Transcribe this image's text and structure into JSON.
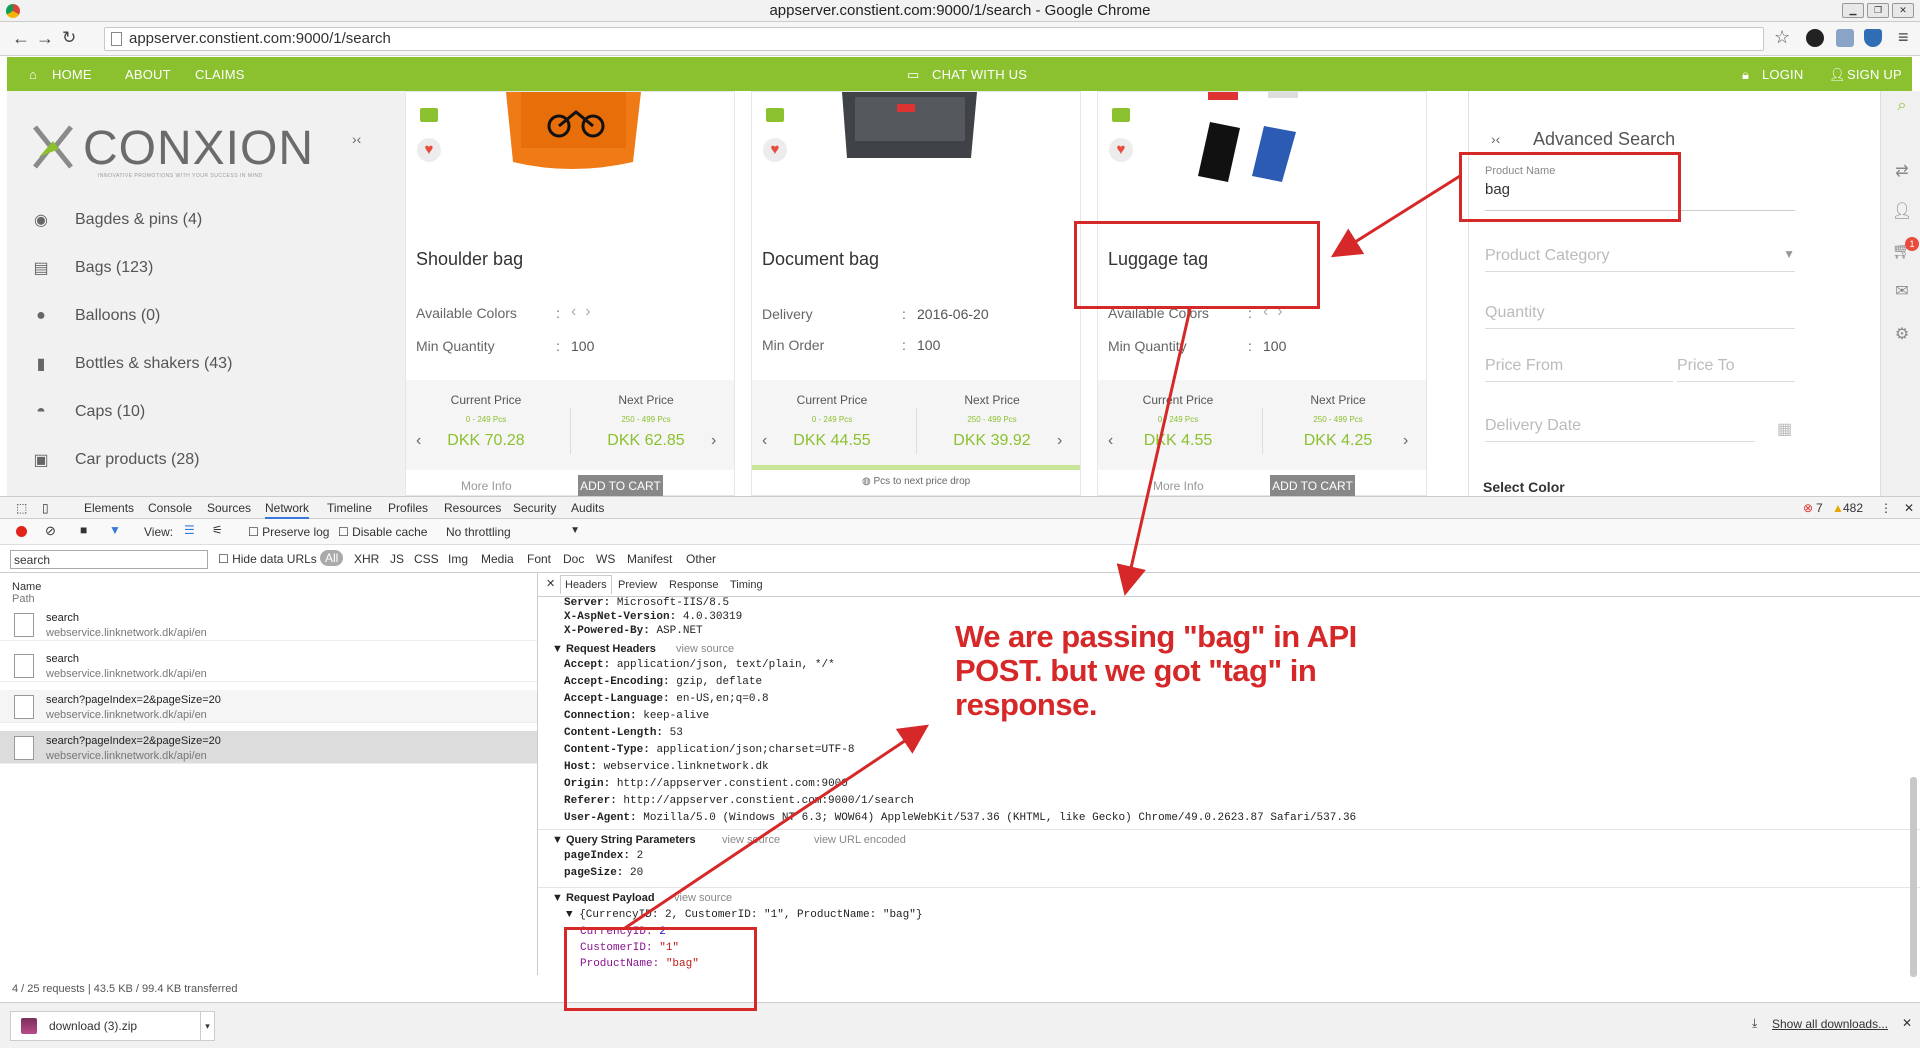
{
  "window": {
    "title": "appserver.constient.com:9000/1/search - Google Chrome"
  },
  "browser": {
    "url": "appserver.constient.com:9000/1/search"
  },
  "sitenav": {
    "home": "HOME",
    "about": "ABOUT",
    "claims": "CLAIMS",
    "chat": "CHAT WITH US",
    "login": "LOGIN",
    "signup": "SIGN UP"
  },
  "brand": {
    "name": "CONXION",
    "tagline": "INNOVATIVE PROMOTIONS WITH YOUR SUCCESS IN MIND"
  },
  "categories": [
    {
      "label": "Bagdes & pins (4)",
      "icon": "badge-icon"
    },
    {
      "label": "Bags (123)",
      "icon": "bag-icon"
    },
    {
      "label": "Balloons (0)",
      "icon": "balloon-icon"
    },
    {
      "label": "Bottles & shakers (43)",
      "icon": "bottle-icon"
    },
    {
      "label": "Caps (10)",
      "icon": "cap-icon"
    },
    {
      "label": "Car products (28)",
      "icon": "car-icon"
    }
  ],
  "products": [
    {
      "title": "Shoulder bag",
      "l1": "Available Colors",
      "v1": "",
      "l2": "Min Quantity",
      "v2": "100",
      "current": "Current Price",
      "next": "Next Price",
      "r1": "0 - 249 Pcs",
      "r2": "250 - 499 Pcs",
      "p1": "DKK 70.28",
      "p2": "DKK 62.85",
      "more": "More Info",
      "cart": "ADD TO CART",
      "note": ""
    },
    {
      "title": "Document bag",
      "l1": "Delivery",
      "v1": "2016-06-20",
      "l2": "Min Order",
      "v2": "100",
      "current": "Current Price",
      "next": "Next Price",
      "r1": "0 - 249 Pcs",
      "r2": "250 - 499 Pcs",
      "p1": "DKK 44.55",
      "p2": "DKK 39.92",
      "more": "",
      "cart": "",
      "note": "Pcs to next price drop"
    },
    {
      "title": "Luggage tag",
      "l1": "Available Colors",
      "v1": "",
      "l2": "Min Quantity",
      "v2": "100",
      "current": "Current Price",
      "next": "Next Price",
      "r1": "0 - 249 Pcs",
      "r2": "250 - 499 Pcs",
      "p1": "DKK 4.55",
      "p2": "DKK 4.25",
      "more": "More Info",
      "cart": "ADD TO CART",
      "note": ""
    }
  ],
  "advanced": {
    "title": "Advanced Search",
    "product_name_label": "Product Name",
    "product_name_value": "bag",
    "category": "Product Category",
    "quantity": "Quantity",
    "price_from": "Price From",
    "price_to": "Price To",
    "delivery": "Delivery Date",
    "select_color": "Select Color",
    "cart_count": "1"
  },
  "devtools": {
    "tabs": [
      "Elements",
      "Console",
      "Sources",
      "Network",
      "Timeline",
      "Profiles",
      "Resources",
      "Security",
      "Audits"
    ],
    "errors": "7",
    "warnings": "482",
    "view_label": "View:",
    "preserve_log": "Preserve log",
    "disable_cache": "Disable cache",
    "throttle": "No throttling",
    "filter_value": "search",
    "hide_data_urls": "Hide data URLs",
    "filters": [
      "All",
      "XHR",
      "JS",
      "CSS",
      "Img",
      "Media",
      "Font",
      "Doc",
      "WS",
      "Manifest",
      "Other"
    ],
    "col_name": "Name",
    "col_path": "Path",
    "requests": [
      {
        "name": "search",
        "path": "webservice.linknetwork.dk/api/en"
      },
      {
        "name": "search",
        "path": "webservice.linknetwork.dk/api/en"
      },
      {
        "name": "search?pageIndex=2&pageSize=20",
        "path": "webservice.linknetwork.dk/api/en"
      },
      {
        "name": "search?pageIndex=2&pageSize=20",
        "path": "webservice.linknetwork.dk/api/en"
      }
    ],
    "detail_tabs": [
      "Headers",
      "Preview",
      "Response",
      "Timing"
    ],
    "response_headers": [
      {
        "k": "Server:",
        "v": "Microsoft-IIS/8.5"
      },
      {
        "k": "X-AspNet-Version:",
        "v": "4.0.30319"
      },
      {
        "k": "X-Powered-By:",
        "v": "ASP.NET"
      }
    ],
    "request_headers_title": "Request Headers",
    "view_source": "view source",
    "view_url_encoded": "view URL encoded",
    "request_headers": [
      {
        "k": "Accept:",
        "v": "application/json, text/plain, */*"
      },
      {
        "k": "Accept-Encoding:",
        "v": "gzip, deflate"
      },
      {
        "k": "Accept-Language:",
        "v": "en-US,en;q=0.8"
      },
      {
        "k": "Connection:",
        "v": "keep-alive"
      },
      {
        "k": "Content-Length:",
        "v": "53"
      },
      {
        "k": "Content-Type:",
        "v": "application/json;charset=UTF-8"
      },
      {
        "k": "Host:",
        "v": "webservice.linknetwork.dk"
      },
      {
        "k": "Origin:",
        "v": "http://appserver.constient.com:9000"
      },
      {
        "k": "Referer:",
        "v": "http://appserver.constient.com:9000/1/search"
      },
      {
        "k": "User-Agent:",
        "v": "Mozilla/5.0 (Windows NT 6.3; WOW64) AppleWebKit/537.36 (KHTML, like Gecko) Chrome/49.0.2623.87 Safari/537.36"
      }
    ],
    "query_title": "Query String Parameters",
    "query": [
      {
        "k": "pageIndex:",
        "v": "2"
      },
      {
        "k": "pageSize:",
        "v": "20"
      }
    ],
    "payload_title": "Request Payload",
    "payload_summary": "{CurrencyID: 2, CustomerID: \"1\", ProductName: \"bag\"}",
    "payload": [
      {
        "k": "CurrencyID:",
        "v": "2"
      },
      {
        "k": "CustomerID:",
        "v": "\"1\""
      },
      {
        "k": "ProductName:",
        "v": "\"bag\""
      }
    ],
    "status": "4 / 25 requests  |  43.5 KB / 99.4 KB transferred"
  },
  "download": {
    "file": "download (3).zip",
    "show_all": "Show all downloads..."
  },
  "annotation": {
    "note": "We are passing \"bag\" in API POST. but we got \"tag\" in response.",
    "color": "#d62828"
  }
}
